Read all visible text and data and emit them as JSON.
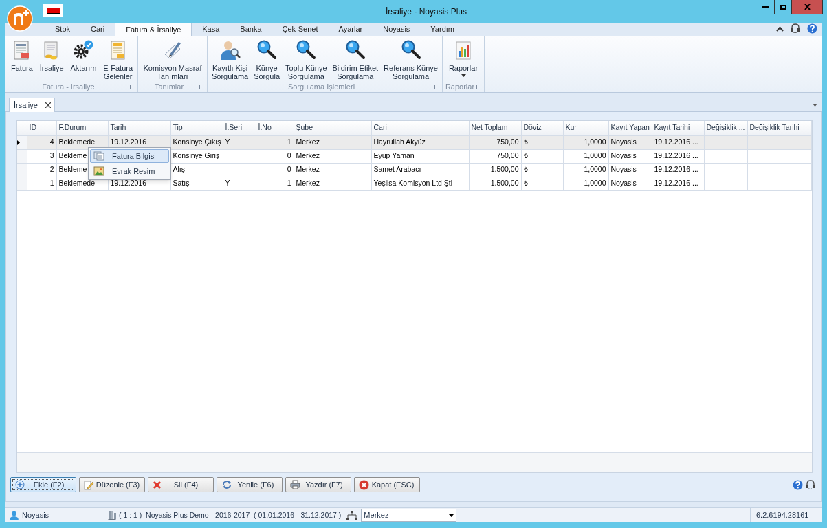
{
  "window": {
    "title": "İrsaliye - Noyasis Plus"
  },
  "ribbon_tabs": [
    {
      "label": "Stok",
      "selected": false
    },
    {
      "label": "Cari",
      "selected": false
    },
    {
      "label": "Fatura & İrsaliye",
      "selected": true
    },
    {
      "label": "Kasa",
      "selected": false
    },
    {
      "label": "Banka",
      "selected": false
    },
    {
      "label": "Çek-Senet",
      "selected": false
    },
    {
      "label": "Ayarlar",
      "selected": false
    },
    {
      "label": "Noyasis",
      "selected": false
    },
    {
      "label": "Yardım",
      "selected": false
    }
  ],
  "ribbon_groups": [
    {
      "title": "Fatura - İrsaliye",
      "items": [
        {
          "label": "Fatura",
          "dropdown": false
        },
        {
          "label": "İrsaliye",
          "dropdown": false
        },
        {
          "label": "Aktarım",
          "dropdown": false
        },
        {
          "label": "E-Fatura\nGelenler",
          "dropdown": false
        }
      ]
    },
    {
      "title": "Tanımlar",
      "items": [
        {
          "label": "Komisyon Masraf\nTanımları",
          "dropdown": false
        }
      ]
    },
    {
      "title": "Sorgulama İşlemleri",
      "items": [
        {
          "label": "Kayıtlı Kişi\nSorgulama",
          "dropdown": false
        },
        {
          "label": "Künye\nSorgula",
          "dropdown": false
        },
        {
          "label": "Toplu Künye\nSorgulama",
          "dropdown": false
        },
        {
          "label": "Bildirim Etiket\nSorgulama",
          "dropdown": false
        },
        {
          "label": "Referans Künye\nSorgulama",
          "dropdown": false
        }
      ]
    },
    {
      "title": "Raporlar",
      "items": [
        {
          "label": "Raporlar",
          "dropdown": true
        }
      ]
    }
  ],
  "document_tabs": [
    {
      "label": "İrsaliye",
      "selected": true
    }
  ],
  "table": {
    "columns": [
      "ID",
      "F.Durum",
      "Tarih",
      "Tip",
      "İ.Seri",
      "İ.No",
      "Şube",
      "Cari",
      "Net Toplam",
      "Döviz",
      "Kur",
      "Kayıt Yapan",
      "Kayıt Tarihi",
      "Değişiklik ...",
      "Değişiklik Tarihi"
    ],
    "rows": [
      {
        "selected": true,
        "cells": [
          "4",
          "Beklemede",
          "19.12.2016",
          "Konsinye Çıkış",
          "Y",
          "1",
          "Merkez",
          "Hayrullah Akyüz",
          "750,00",
          "₺",
          "1,0000",
          "Noyasis",
          "19.12.2016 ...",
          null,
          null
        ]
      },
      {
        "selected": false,
        "cells": [
          "3",
          "Bekleme",
          null,
          "Konsinye Giriş",
          null,
          "0",
          "Merkez",
          "Eyüp Yaman",
          "750,00",
          "₺",
          "1,0000",
          "Noyasis",
          "19.12.2016 ...",
          null,
          null
        ]
      },
      {
        "selected": false,
        "cells": [
          "2",
          "Bekleme",
          null,
          "Alış",
          null,
          "0",
          "Merkez",
          "Samet Arabacı",
          "1.500,00",
          "₺",
          "1,0000",
          "Noyasis",
          "19.12.2016 ...",
          null,
          null
        ]
      },
      {
        "selected": false,
        "cells": [
          "1",
          "Beklemede",
          "19.12.2016",
          "Satış",
          "Y",
          "1",
          "Merkez",
          "Yeşilsa Komisyon Ltd Şti",
          "1.500,00",
          "₺",
          "1,0000",
          "Noyasis",
          "19.12.2016 ...",
          null,
          null
        ]
      }
    ]
  },
  "context_menu": {
    "items": [
      {
        "label": "Fatura Bilgisi",
        "selected": true
      },
      {
        "label": "Evrak Resim",
        "selected": false
      }
    ]
  },
  "buttons": [
    {
      "label": "Ekle (F2)",
      "focused": true
    },
    {
      "label": "Düzenle (F3)",
      "focused": false
    },
    {
      "label": "Sil (F4)",
      "focused": false
    },
    {
      "label": "Yenile (F6)",
      "focused": false
    },
    {
      "label": "Yazdır (F7)",
      "focused": false
    },
    {
      "label": "Kapat (ESC)",
      "focused": false
    }
  ],
  "status_bar": {
    "user": "Noyasis",
    "database": "( 1 : 1 )  Noyasis Plus Demo - 2016-2017  ( 01.01.2016 - 31.12.2017 )",
    "branch": "Merkez",
    "version": "6.2.6194.28161"
  }
}
